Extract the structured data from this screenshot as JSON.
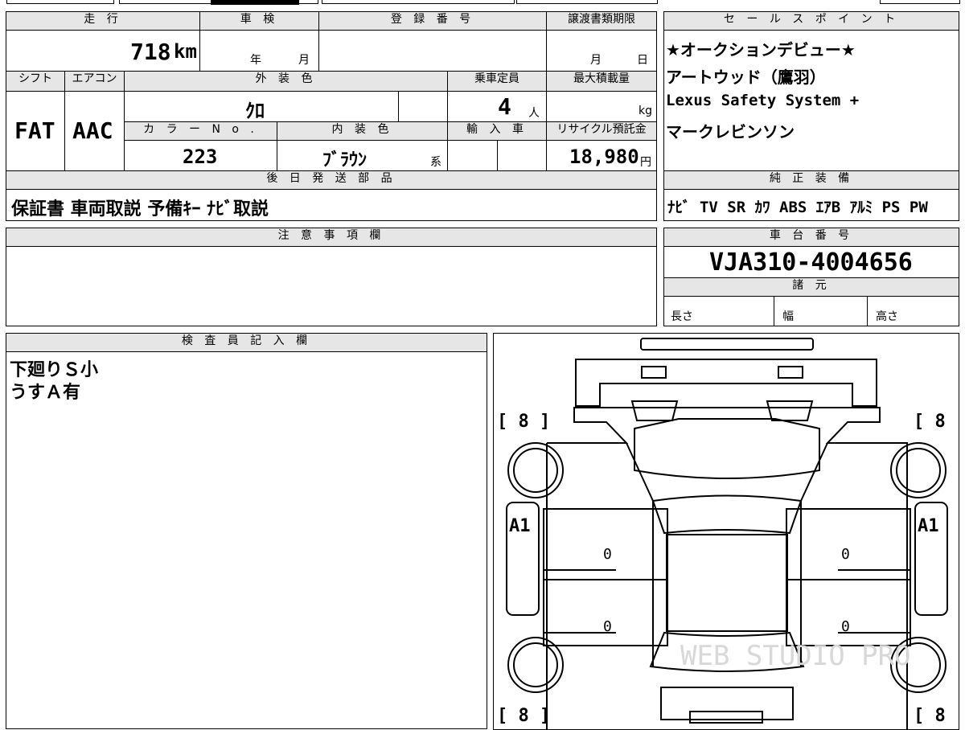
{
  "sheet": {
    "top_strip": [
      "",
      "",
      "",
      "",
      ""
    ],
    "headers": {
      "mileage": "走 行",
      "inspection": "車 検",
      "registration_no": "登 録 番 号",
      "transfer_deadline": "譲渡書類期限",
      "shift": "シフト",
      "aircon": "エアコン",
      "exterior_color": "外 装 色",
      "capacity": "乗車定員",
      "max_load": "最大積載量",
      "color_no": "カ ラ ー N o .",
      "interior_color": "内 装 色",
      "import": "輸 入 車",
      "recycle": "リサイクル預託金",
      "later_parts": "後 日 発 送 部 品",
      "notes": "注 意 事 項 欄",
      "sales_points": "セ ー ル ス ポ イ ン ト",
      "equipment": "純 正 装 備",
      "chassis": "車 台 番 号",
      "specs": "諸 元",
      "inspector": "検 査 員 記 入 欄"
    },
    "mileage": {
      "value": "718",
      "unit": "km"
    },
    "inspection": {
      "year_unit": "年",
      "month_unit": "月"
    },
    "transfer_deadline": {
      "month_unit": "月",
      "day_unit": "日"
    },
    "shift": "FAT",
    "aircon": "AAC",
    "exterior_color": "ｸﾛ",
    "capacity": {
      "value": "4",
      "unit": "人"
    },
    "max_load": {
      "unit": "kg"
    },
    "color_no": "223",
    "interior_color": {
      "value": "ﾌﾞﾗｳﾝ",
      "suffix": "系"
    },
    "recycle": {
      "value": "18,980",
      "unit": "円"
    },
    "later_parts": "保証書 車両取説 予備ｷｰ ﾅﾋﾞ取説",
    "sales_points": [
      "★オークションデビュー★",
      "アートウッド（鷹羽）",
      "Lexus Safety System +",
      "マークレビンソン"
    ],
    "equipment": "ﾅﾋﾞ TV SR ｶﾜ ABS ｴｱB ｱﾙﾐ PS PW",
    "chassis_no": "VJA310-4004656",
    "specs": {
      "length": "長さ",
      "width": "幅",
      "height": "高さ"
    },
    "inspector_notes": [
      "下廻りＳ小",
      "うすＡ有"
    ]
  },
  "diagram": {
    "tire_tread": [
      "[ 8 ]",
      "[ 8 ]",
      "[ 8 ]",
      "[ 8 ]"
    ],
    "panel_marks": {
      "left_front": "A1",
      "right_front": "A1"
    },
    "door_values": [
      "0",
      "0",
      "0",
      "0"
    ],
    "watermark": "WEB STUDIO PRO"
  }
}
